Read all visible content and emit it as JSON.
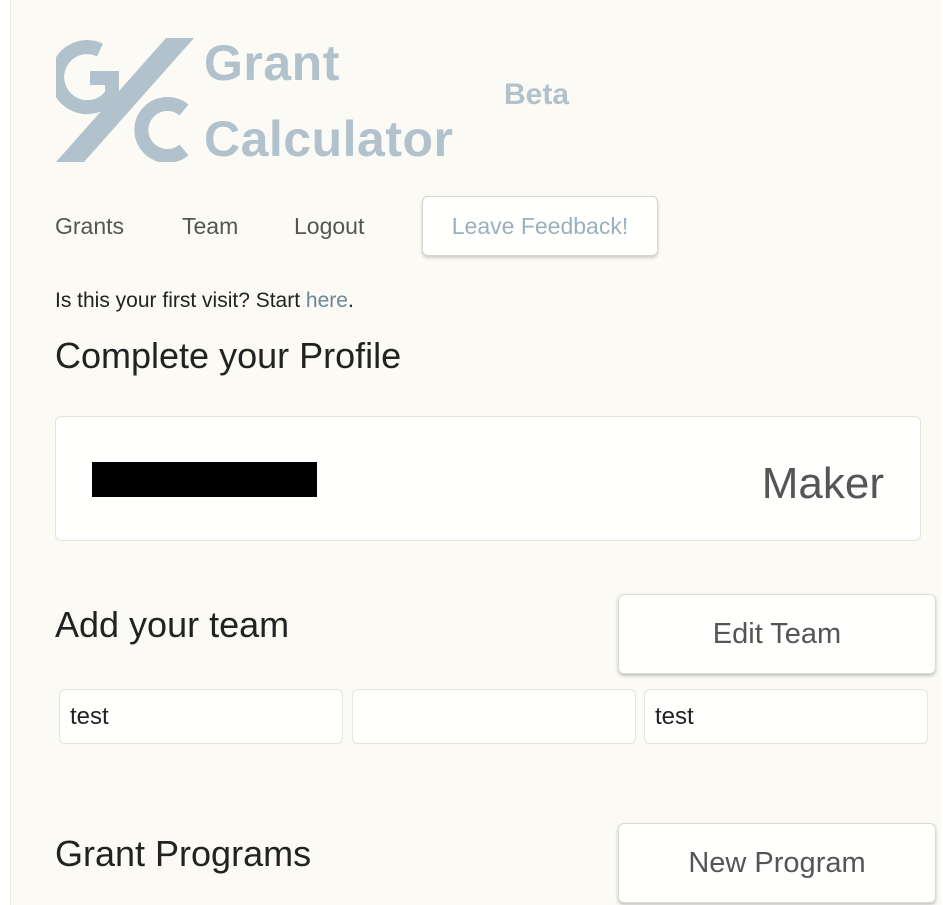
{
  "logo": {
    "line1": "Grant",
    "line2": "Calculator",
    "badge": "Beta",
    "color": "#b1c2cc"
  },
  "nav": {
    "grants": "Grants",
    "team": "Team",
    "logout": "Logout",
    "feedback": "Leave Feedback!"
  },
  "first_visit": {
    "text": "Is this your first visit? Start ",
    "link": "here",
    "suffix": "."
  },
  "profile": {
    "heading": "Complete your Profile",
    "role": "Maker"
  },
  "team": {
    "heading": "Add your team",
    "edit_button": "Edit Team",
    "fields": [
      {
        "value": "test"
      },
      {
        "value": ""
      },
      {
        "value": "test"
      }
    ]
  },
  "programs": {
    "heading": "Grant Programs",
    "new_button": "New Program"
  },
  "colors": {
    "background": "#fbfaf5",
    "accent": "#b1c2cc",
    "link": "#6a8798"
  }
}
